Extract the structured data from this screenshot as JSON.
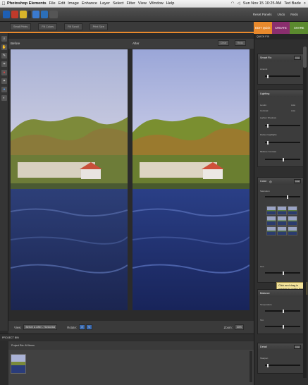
{
  "menubar": {
    "apple": "",
    "app_name": "Photoshop Elements",
    "items": [
      "File",
      "Edit",
      "Image",
      "Enhance",
      "Layer",
      "Select",
      "Filter",
      "View",
      "Window",
      "Help"
    ],
    "clock": "Sun Nov 15  10:25 AM",
    "user": "Ted Bade"
  },
  "appbar": {
    "reset_panels": "Reset Panels",
    "undo": "Undo",
    "redo": "Redo"
  },
  "doc_tabs": [
    "Small Prints",
    "Fill Colors",
    "Fill Scroll",
    "Print Size"
  ],
  "mode_tabs": [
    {
      "label": "EDIT Quick",
      "color": "#e8892c"
    },
    {
      "label": "CREATE",
      "color": "#8a2e6e"
    },
    {
      "label": "SHARE",
      "color": "#5b8a2e"
    }
  ],
  "view": {
    "before_label": "Before",
    "after_label": "After",
    "clear_btn": "Clear",
    "redo_btn": "Redo",
    "view_label": "View:",
    "view_value": "Before & After - Horizontal",
    "rotate_label": "Rotate:",
    "zoom_label": "Zoom:",
    "zoom_value": "33%"
  },
  "bin": {
    "header": "PROJECT BIN",
    "subheader": "Project Bin: All Items"
  },
  "panel": {
    "title": "QUICK FIX",
    "smart_fix": {
      "title": "Smart Fix",
      "auto": "Auto",
      "amount_label": "Amount"
    },
    "lighting": {
      "title": "Lighting",
      "levels": "Levels:",
      "contrast": "Contrast:",
      "auto": "Auto",
      "lighten_shadows": "Lighten Shadows",
      "darken_highlights": "Darken Highlights",
      "midtone_contrast": "Midtone Contrast"
    },
    "color": {
      "title": "Color",
      "saturation": "Saturation",
      "hue": "Hue",
      "tooltip": "Click and drag in preview to make fine adjustments"
    },
    "balance": {
      "title": "Balance",
      "temperature": "Temperature",
      "tint": "Tint"
    },
    "detail": {
      "title": "Detail",
      "auto": "Auto",
      "sharpen": "Sharpen"
    }
  },
  "colors": {
    "accent": "#e8892c",
    "panel_bg": "#2f2f2f"
  }
}
